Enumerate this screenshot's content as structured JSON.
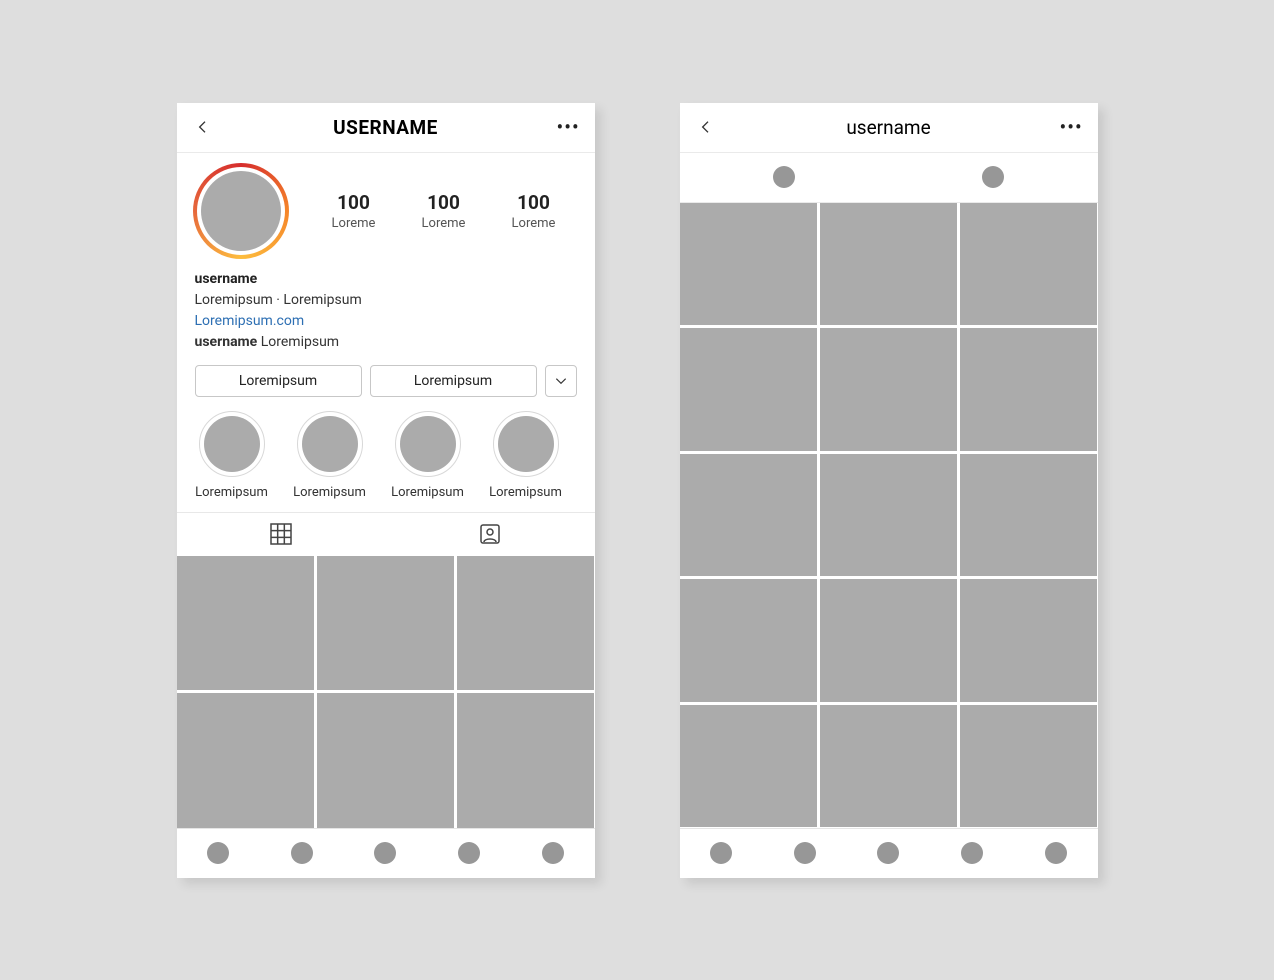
{
  "phoneA": {
    "header_title": "USERNAME",
    "stats": [
      {
        "value": "100",
        "label": "Loreme"
      },
      {
        "value": "100",
        "label": "Loreme"
      },
      {
        "value": "100",
        "label": "Loreme"
      }
    ],
    "bio": {
      "display_name": "username",
      "tagline": "Loremipsum · Loremipsum",
      "link_text": "Loremipsum.com",
      "followed_by_user": "username",
      "followed_by_rest": "Loremipsum"
    },
    "actions": {
      "primary": "Loremipsum",
      "secondary": "Loremipsum"
    },
    "highlights": [
      {
        "label": "Loremipsum"
      },
      {
        "label": "Loremipsum"
      },
      {
        "label": "Loremipsum"
      },
      {
        "label": "Loremipsum"
      }
    ],
    "grid_cells": 6,
    "nav_count": 5
  },
  "phoneB": {
    "header_title": "username",
    "segment_count": 2,
    "grid_cells": 15,
    "nav_count": 5
  }
}
